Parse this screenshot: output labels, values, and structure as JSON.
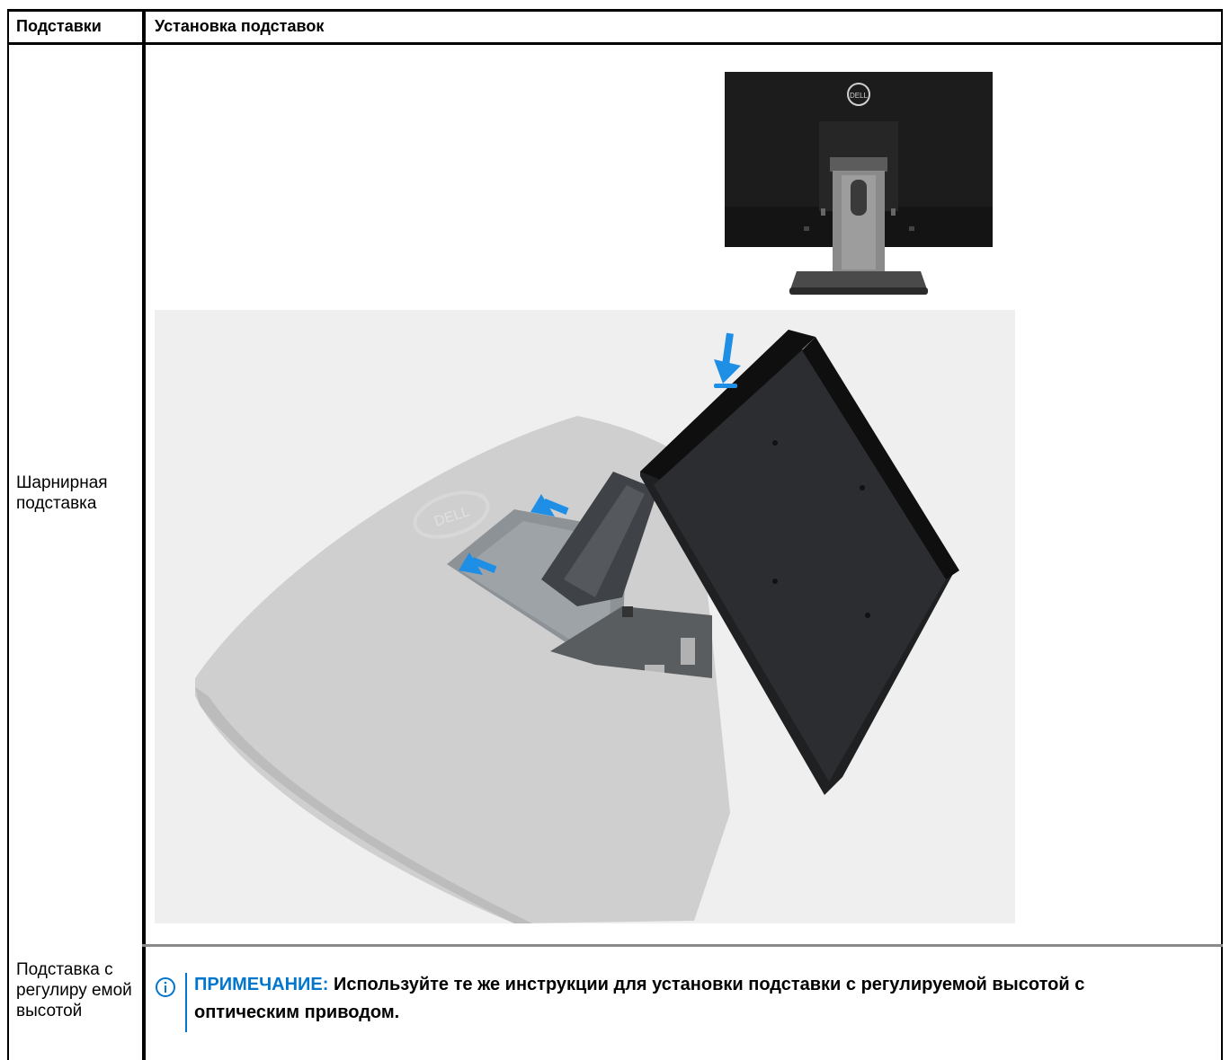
{
  "table": {
    "headers": [
      "Подставки",
      "Установка подставок"
    ],
    "rows": [
      {
        "label": "Шарнирная подставка"
      },
      {
        "label": "Подставка с регулиру емой высотой"
      }
    ]
  },
  "note": {
    "label": "ПРИМЕЧАНИЕ:",
    "text": "Используйте те же инструкции для установки подставки с регулируемой высотой с оптическим приводом."
  },
  "images": {
    "monitor_logo": "DELL",
    "stand_logo": "DELL"
  },
  "colors": {
    "accent": "#0076ce",
    "arrow": "#1f8fe6",
    "grid": "#000000"
  }
}
